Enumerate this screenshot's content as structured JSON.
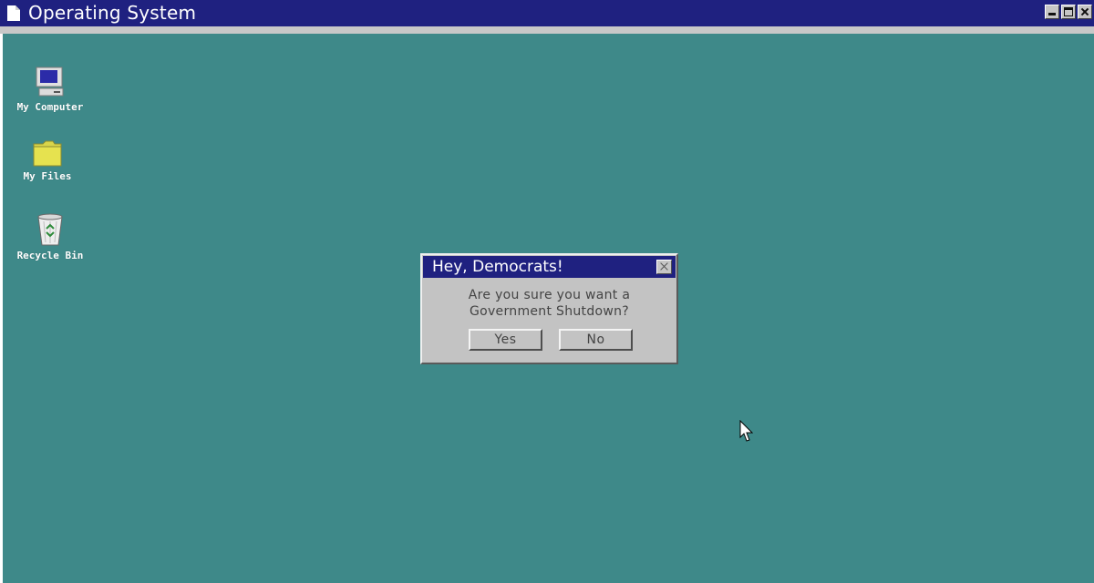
{
  "window": {
    "title": "Operating System",
    "icon": "document-icon",
    "controls": [
      "minimize-icon",
      "maximize-icon",
      "close-icon"
    ],
    "colors": {
      "titlebar": "#1f2180",
      "desktop": "#3e8989",
      "frame": "#c8c8c8"
    }
  },
  "desktop": {
    "icons": [
      {
        "label": "My Computer",
        "icon": "computer-icon"
      },
      {
        "label": "My Files",
        "icon": "folder-icon"
      },
      {
        "label": "Recycle Bin",
        "icon": "recycle-bin-icon"
      }
    ]
  },
  "dialog": {
    "title": "Hey, Democrats!",
    "message_line1": "Are you sure you want a",
    "message_line2": "Government Shutdown?",
    "yes_label": "Yes",
    "no_label": "No",
    "close_icon": "close-icon"
  },
  "cursor": {
    "icon": "mouse-pointer-icon"
  }
}
